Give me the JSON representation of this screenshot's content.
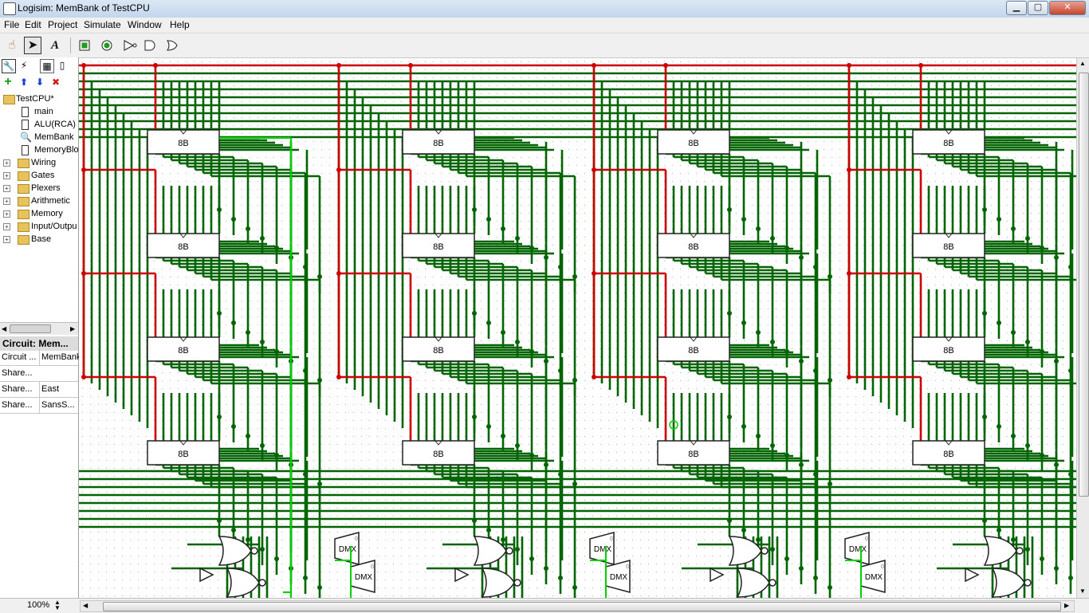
{
  "window": {
    "title": "Logisim: MemBank of TestCPU",
    "min": "▁",
    "max": "▢",
    "close": "✕"
  },
  "menu": {
    "items": [
      "File",
      "Edit",
      "Project",
      "Simulate",
      "Window",
      "Help"
    ]
  },
  "toolbar": {
    "tools": [
      "hand-poke-icon",
      "select-arrow-icon",
      "text-tool-icon",
      "input-pin-icon",
      "output-pin-icon",
      "not-gate-icon",
      "and-gate-icon",
      "or-gate-icon"
    ],
    "text_tool_label": "A"
  },
  "explorer": {
    "project": "TestCPU*",
    "circuits": [
      "main",
      "ALU(RCA)",
      "MemBank",
      "MemoryBlo"
    ],
    "libraries": [
      "Wiring",
      "Gates",
      "Plexers",
      "Arithmetic",
      "Memory",
      "Input/Outpu",
      "Base"
    ]
  },
  "attributes": {
    "title": "Circuit: Mem...",
    "rows": [
      {
        "key": "Circuit ...",
        "value": "MemBank"
      },
      {
        "key": "Share...",
        "value": ""
      },
      {
        "key": "Share...",
        "value": "East"
      },
      {
        "key": "Share...",
        "value": "SansS..."
      }
    ]
  },
  "circuit": {
    "register_label": "8B",
    "demux_label": "DMX",
    "demux_select": "0",
    "colors": {
      "wire": "#006400",
      "bus": "#cc0000",
      "active": "#00d200",
      "grid": "#b5b5b5"
    },
    "columns": 4,
    "rows": 4
  },
  "status": {
    "zoom": "100%"
  }
}
